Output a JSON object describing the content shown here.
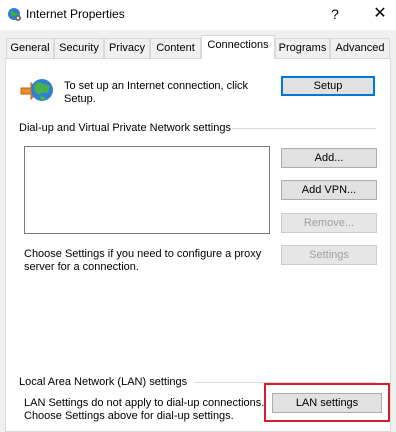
{
  "window": {
    "title": "Internet Properties",
    "help_glyph": "?",
    "close_glyph": "✕"
  },
  "tabs": [
    {
      "label": "General"
    },
    {
      "label": "Security"
    },
    {
      "label": "Privacy"
    },
    {
      "label": "Content"
    },
    {
      "label": "Connections",
      "active": true
    },
    {
      "label": "Programs"
    },
    {
      "label": "Advanced"
    }
  ],
  "setup": {
    "text": "To set up an Internet connection, click Setup.",
    "button": "Setup"
  },
  "dialup": {
    "group_label": "Dial-up and Virtual Private Network settings",
    "add_button": "Add...",
    "add_vpn_button": "Add VPN...",
    "remove_button": "Remove...",
    "settings_button": "Settings",
    "proxy_text": "Choose Settings if you need to configure a proxy server for a connection."
  },
  "lan": {
    "group_label": "Local Area Network (LAN) settings",
    "text": "LAN Settings do not apply to dial-up connections. Choose Settings above for dial-up settings.",
    "button": "LAN settings"
  },
  "colors": {
    "highlight": "#d11f2b",
    "accent": "#0078d7"
  }
}
